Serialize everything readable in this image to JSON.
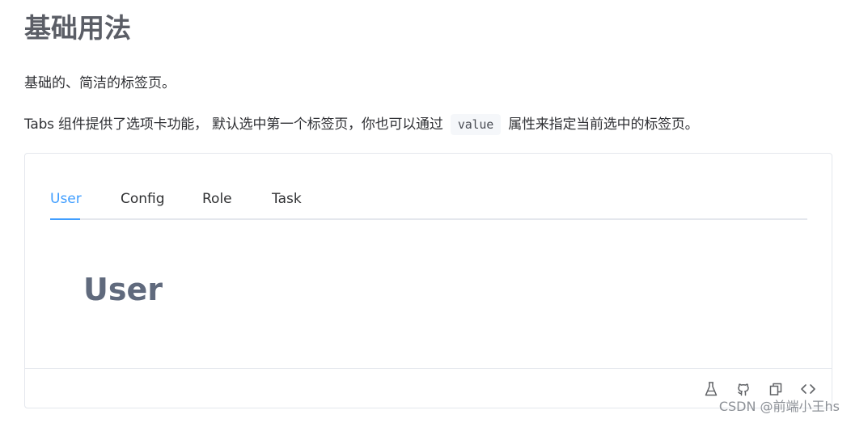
{
  "page": {
    "title": "基础用法",
    "subtitle": "基础的、简洁的标签页。",
    "description_before": "Tabs 组件提供了选项卡功能， 默认选中第一个标签页，你也可以通过",
    "description_code": "value",
    "description_after": "属性来指定当前选中的标签页。"
  },
  "tabs": {
    "items": [
      {
        "label": "User",
        "active": true
      },
      {
        "label": "Config",
        "active": false
      },
      {
        "label": "Role",
        "active": false
      },
      {
        "label": "Task",
        "active": false
      }
    ],
    "active_content": "User",
    "accent_color": "#409eff"
  },
  "footer_icons": [
    "flask-icon",
    "github-icon",
    "copy-icon",
    "code-icon"
  ],
  "watermark": "CSDN @前端小王hs"
}
